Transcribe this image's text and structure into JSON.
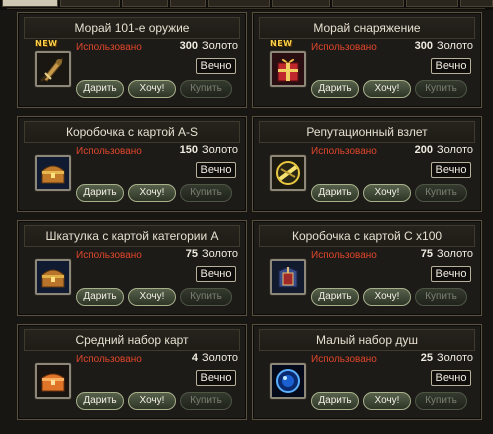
{
  "labels": {
    "used": "Использовано",
    "currency": "Золото",
    "duration": "Вечно",
    "gift": "Дарить",
    "want": "Хочу!",
    "buy": "Купить",
    "new": "NEW"
  },
  "items": [
    {
      "title": "Морай 101-е оружие",
      "price": "300",
      "is_new": true,
      "icon": "weapon-icon"
    },
    {
      "title": "Морай снаряжение",
      "price": "300",
      "is_new": true,
      "icon": "gift-box-icon"
    },
    {
      "title": "Коробочка с картой A-S",
      "price": "150",
      "is_new": false,
      "icon": "treasure-chest-icon"
    },
    {
      "title": "Репутационный взлет",
      "price": "200",
      "is_new": false,
      "icon": "reputation-scroll-icon"
    },
    {
      "title": "Шкатулка с картой категории A",
      "price": "75",
      "is_new": false,
      "icon": "treasure-chest-icon"
    },
    {
      "title": "Коробочка с картой C x100",
      "price": "75",
      "is_new": false,
      "icon": "card-box-icon"
    },
    {
      "title": "Средний набор карт",
      "price": "4",
      "is_new": false,
      "icon": "orange-chest-icon"
    },
    {
      "title": "Малый набор душ",
      "price": "25",
      "is_new": false,
      "icon": "soul-orb-icon"
    }
  ]
}
